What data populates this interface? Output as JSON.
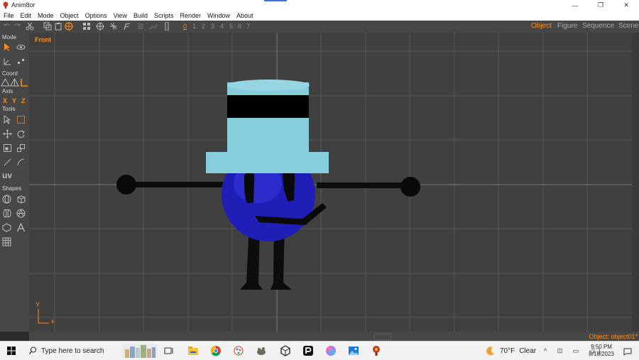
{
  "window": {
    "title": "Anim8or",
    "minimize_glyph": "—",
    "restore_glyph": "❐",
    "close_glyph": "✕"
  },
  "menu": [
    "File",
    "Edit",
    "Mode",
    "Object",
    "Options",
    "View",
    "Build",
    "Scripts",
    "Render",
    "Window",
    "About"
  ],
  "toolbar": {
    "numbers": [
      "0",
      "1",
      "2",
      "3",
      "4",
      "5",
      "6",
      "7"
    ],
    "active_number": "0",
    "modes": [
      "Object",
      "Figure",
      "Sequence",
      "Scene"
    ],
    "active_mode": "Object"
  },
  "left_panel": {
    "sections": {
      "mode": "Mode",
      "coord": "Coord",
      "axis": "Axis",
      "tools": "Tools",
      "shapes": "Shapes"
    },
    "axis_buttons": [
      "X",
      "Y",
      "Z"
    ],
    "uv_label": "uv"
  },
  "viewport": {
    "view_label": "Front",
    "axis_y": "Y",
    "axis_x": "x"
  },
  "status": {
    "object": "Object: object01*"
  },
  "taskbar": {
    "search_placeholder": "Type here to search",
    "weather": {
      "temp": "70°F",
      "condition": "Clear"
    },
    "time": "9:50 PM",
    "date": "8/18/2023",
    "tray_glyphs": "^ ⊡ ▭ ◁)"
  },
  "colors": {
    "accent": "#ff8c1a",
    "hat": "#87cedc",
    "hat_band": "#000000",
    "body": "#1f1fb8",
    "viewport_bg": "#404040",
    "grid_line": "#595959"
  }
}
